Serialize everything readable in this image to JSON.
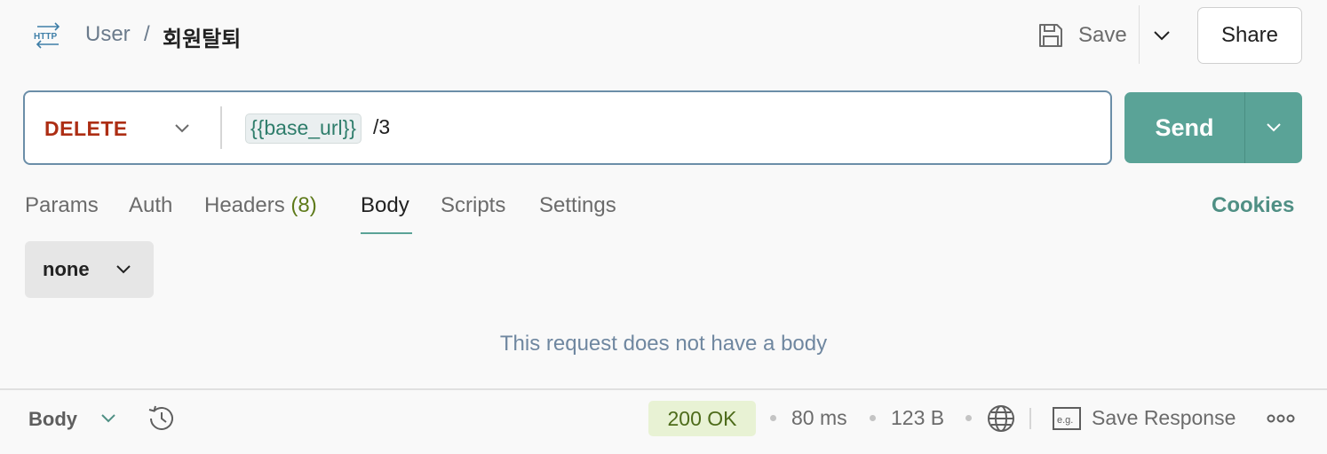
{
  "header": {
    "breadcrumb_parent": "User",
    "breadcrumb_separator": "/",
    "request_name": "회원탈퇴",
    "save_label": "Save",
    "share_label": "Share"
  },
  "request": {
    "method": "DELETE",
    "url_variable": "{{base_url}}",
    "url_path": "/3",
    "send_label": "Send"
  },
  "tabs": [
    {
      "label": "Params"
    },
    {
      "label": "Auth"
    },
    {
      "label": "Headers",
      "count": "(8)"
    },
    {
      "label": "Body",
      "active": true
    },
    {
      "label": "Scripts"
    },
    {
      "label": "Settings"
    }
  ],
  "cookies_label": "Cookies",
  "body": {
    "type_selected": "none",
    "empty_message": "This request does not have a body"
  },
  "response_bar": {
    "view_label": "Body",
    "status": "200 OK",
    "time": "80 ms",
    "size": "123 B",
    "save_response_label": "Save Response"
  },
  "icons": {
    "http": "http-icon",
    "save": "floppy-disk-icon",
    "history": "history-icon",
    "globe": "globe-icon",
    "example": "eg-icon",
    "more": "ellipsis-icon"
  },
  "colors": {
    "method_delete": "#ad2e14",
    "send_button": "#5aa397",
    "cookies_link": "#4f8f84",
    "status_ok_bg": "#e8f2d4",
    "status_ok_text": "#4d6b1a",
    "url_variable": "#2e7d6b"
  }
}
